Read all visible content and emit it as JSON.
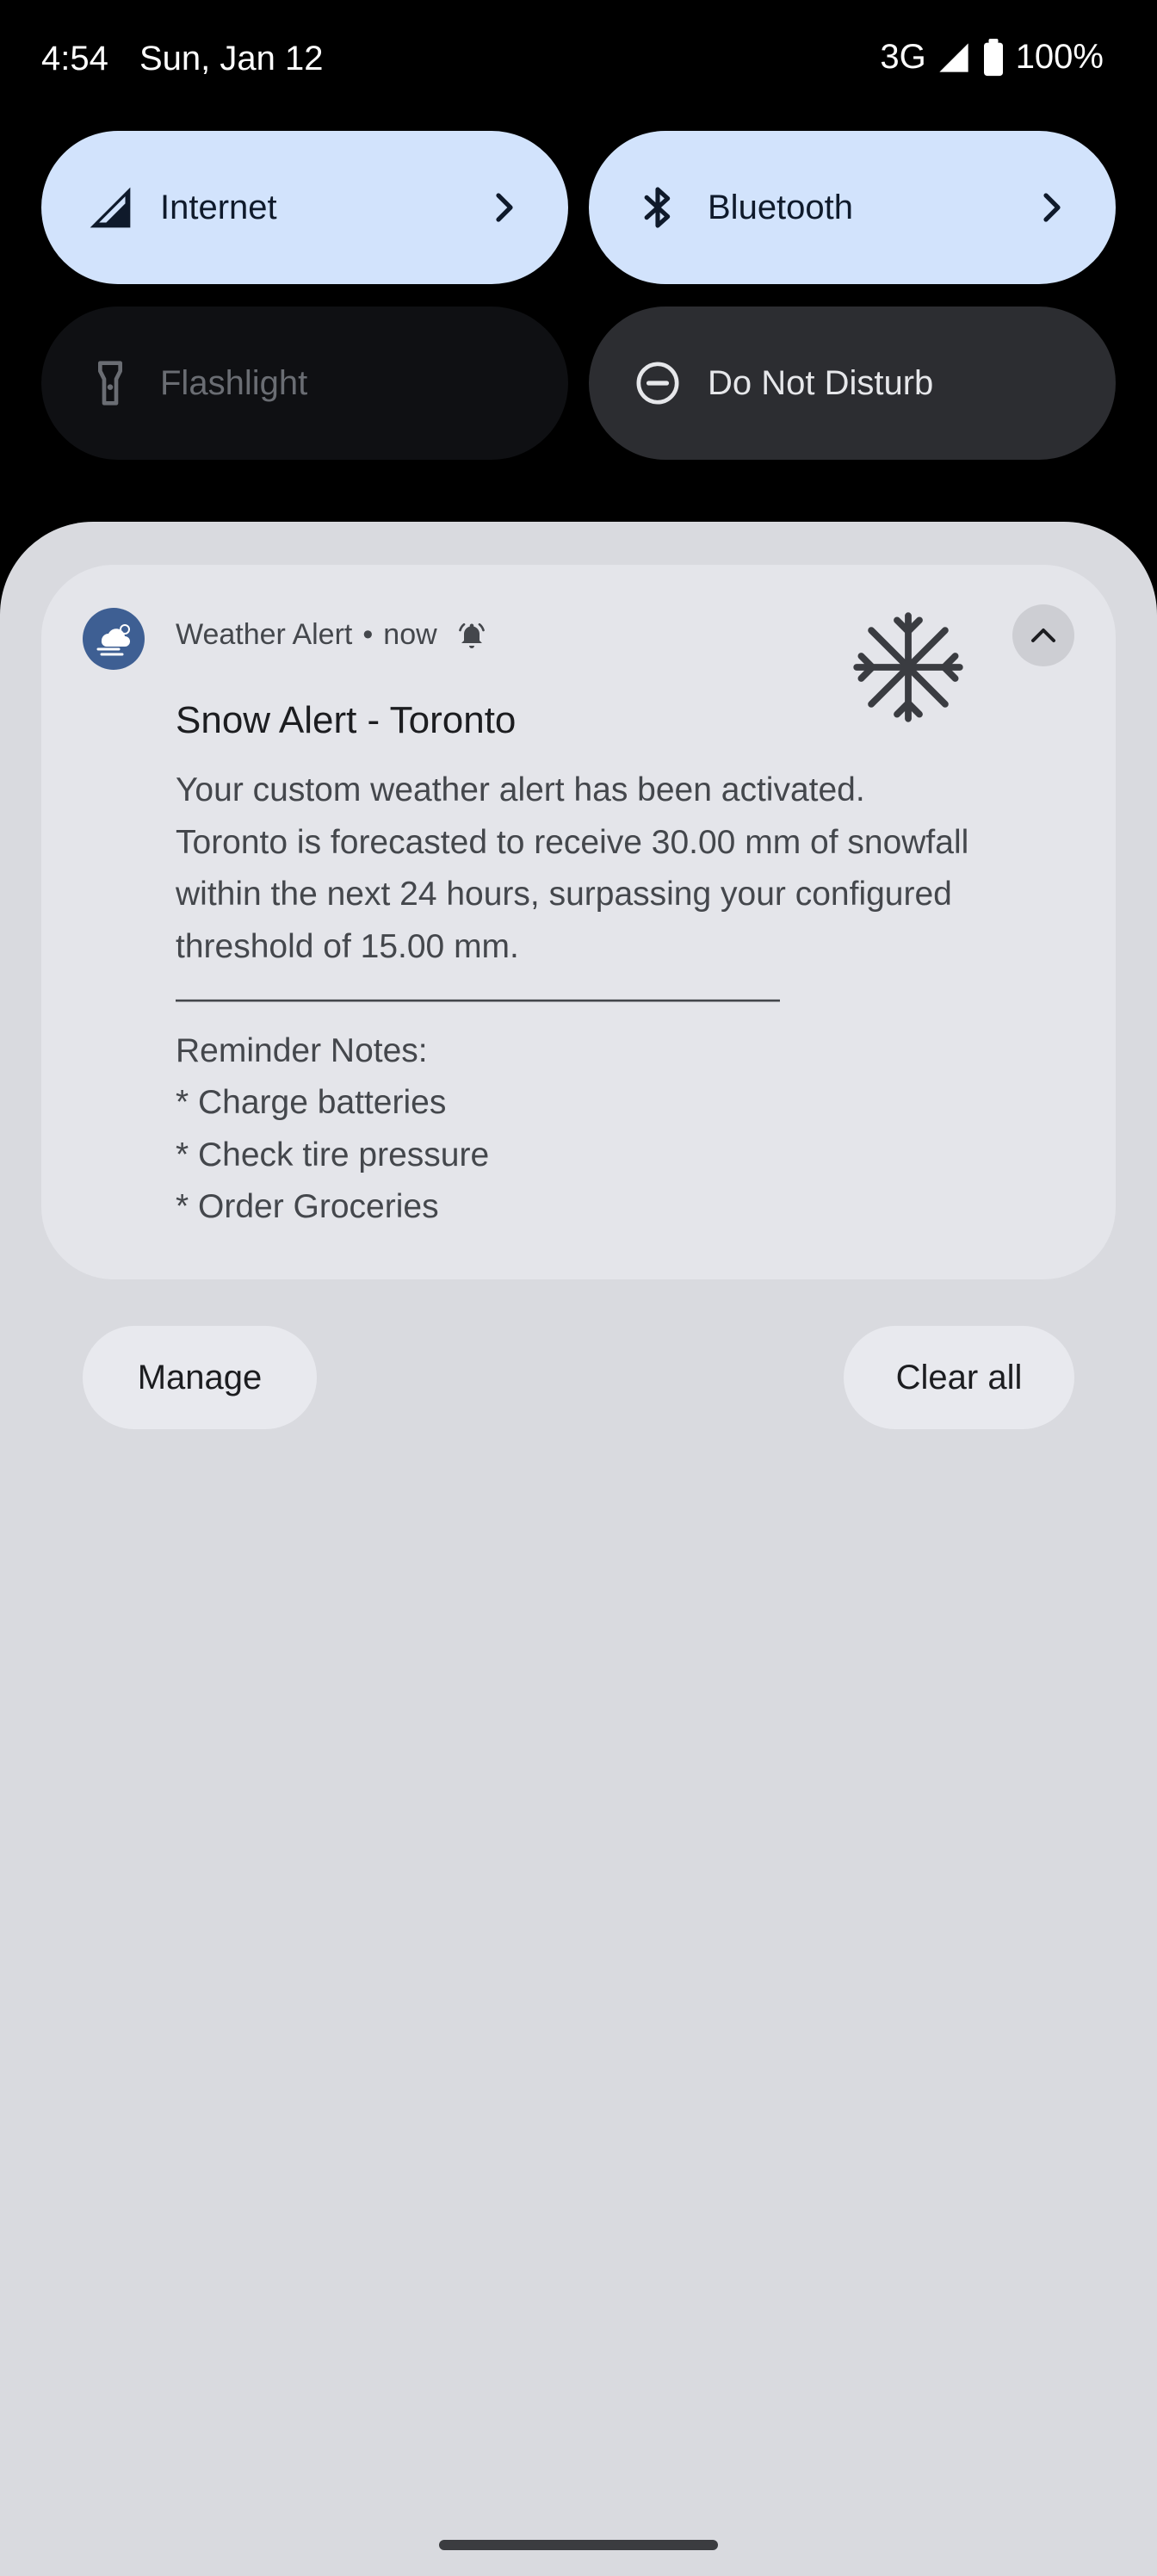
{
  "status_bar": {
    "time": "4:54",
    "date": "Sun, Jan 12",
    "network": "3G",
    "battery": "100%",
    "icons": [
      "signal-icon",
      "battery-icon"
    ]
  },
  "quick_settings": {
    "tiles": [
      {
        "label": "Internet",
        "icon": "signal-icon",
        "state": "on",
        "has_chevron": true
      },
      {
        "label": "Bluetooth",
        "icon": "bluetooth-icon",
        "state": "on",
        "has_chevron": true
      },
      {
        "label": "Flashlight",
        "icon": "flashlight-icon",
        "state": "unavailable"
      },
      {
        "label": "Do Not Disturb",
        "icon": "do-not-disturb-icon",
        "state": "off"
      }
    ]
  },
  "notification": {
    "app_name": "Weather Alert",
    "separator": "•",
    "time": "now",
    "title": "Snow Alert - Toronto",
    "body_lines": [
      "Your custom weather alert has been activated.",
      "Toronto is forecasted to receive 30.00 mm of snowfall",
      "within the next 24 hours, surpassing your configured",
      "threshold of 15.00 mm.",
      "——————————————————",
      "Reminder Notes:",
      "* Charge batteries",
      "* Check tire pressure",
      "* Order Groceries"
    ],
    "icons": [
      "weather-app-icon",
      "bell-icon",
      "snowflake-icon",
      "chevron-up-icon"
    ]
  },
  "actions": {
    "manage_label": "Manage",
    "clear_all_label": "Clear all"
  },
  "colors": {
    "tile_active": "#d2e3fc",
    "shade_background": "#d9dadf",
    "card_background": "#e4e5ea",
    "app_icon": "#3e5f93"
  }
}
